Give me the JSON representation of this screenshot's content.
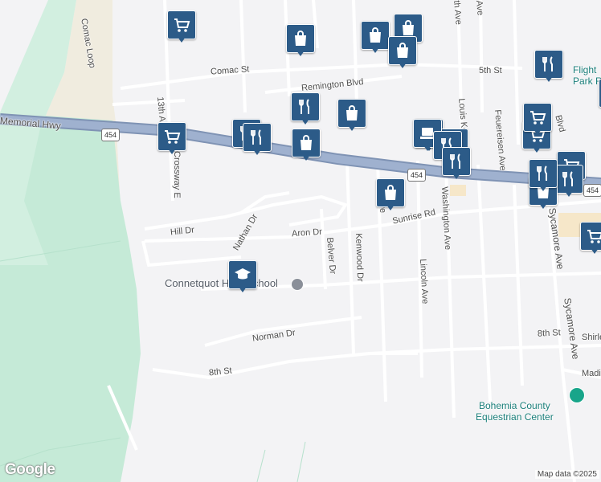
{
  "map": {
    "highway": {
      "name": "Memorial Hwy",
      "route_number": "454"
    },
    "streets": [
      {
        "id": "comac-loop",
        "name": "Comac Loop"
      },
      {
        "id": "comac-st",
        "name": "Comac St"
      },
      {
        "id": "remington-blvd",
        "name": "Remington Blvd"
      },
      {
        "id": "13th-ave",
        "name": "13th A"
      },
      {
        "id": "crossway-e",
        "name": "Crossway E"
      },
      {
        "id": "hill-dr",
        "name": "Hill Dr"
      },
      {
        "id": "nathan-dr",
        "name": "Nathan Dr"
      },
      {
        "id": "aron-dr",
        "name": "Aron Dr"
      },
      {
        "id": "belver-dr",
        "name": "Belver Dr"
      },
      {
        "id": "kenwood-dr",
        "name": "Kenwood Dr"
      },
      {
        "id": "sunrise-rd",
        "name": "Sunrise Rd"
      },
      {
        "id": "lincoln-ave",
        "name": "Lincoln Ave"
      },
      {
        "id": "washington-ave",
        "name": "Washington Ave"
      },
      {
        "id": "louis-kossuth",
        "name": "Louis Kossuth"
      },
      {
        "id": "feuereisen-ave",
        "name": "Feuereisen Ave"
      },
      {
        "id": "sycamore-ave",
        "name": "Sycamore Ave"
      },
      {
        "id": "5th-st",
        "name": "5th St"
      },
      {
        "id": "8th-st-east",
        "name": "8th St"
      },
      {
        "id": "8th-st-west",
        "name": "8th St"
      },
      {
        "id": "norman-dr",
        "name": "Norman Dr"
      },
      {
        "id": "shirley",
        "name": "Shirley"
      },
      {
        "id": "madi",
        "name": "Madi"
      },
      {
        "id": "lt-ave",
        "name": "lt Ave"
      },
      {
        "id": "th-ave",
        "name": "th Ave"
      },
      {
        "id": "blvd",
        "name": "Blvd"
      },
      {
        "id": "ave-top",
        "name": "Ave"
      }
    ],
    "places": {
      "school": "Connetquot High School",
      "equestrian_line1": "Bohemia County",
      "equestrian_line2": "Equestrian Center",
      "flight_line1": "Flight",
      "flight_line2": "Park Re"
    },
    "pins": [
      {
        "type": "cart-icon"
      },
      {
        "type": "bag-icon"
      },
      {
        "type": "bag-icon"
      },
      {
        "type": "bag-icon"
      },
      {
        "type": "bag-icon"
      },
      {
        "type": "fork-knife-icon"
      },
      {
        "type": "fork-knife-icon"
      },
      {
        "type": "bag-icon"
      },
      {
        "type": "fork-knife-icon"
      },
      {
        "type": "cart-icon"
      },
      {
        "type": "fork-knife-icon"
      },
      {
        "type": "fork-knife-icon"
      },
      {
        "type": "bag-icon"
      },
      {
        "type": "laptop-icon"
      },
      {
        "type": "cart-icon"
      },
      {
        "type": "fork-knife-icon"
      },
      {
        "type": "fork-knife-icon"
      },
      {
        "type": "cart-icon"
      },
      {
        "type": "fork-knife-icon"
      },
      {
        "type": "cart-icon"
      },
      {
        "type": "fork-knife-icon"
      },
      {
        "type": "bag-icon"
      },
      {
        "type": "bag-icon"
      },
      {
        "type": "cart-icon"
      },
      {
        "type": "graduation-cap-icon"
      },
      {
        "type": "fork-knife-icon"
      },
      {
        "type": "bag-icon"
      }
    ],
    "attribution": {
      "logo": "Google",
      "copyright": "Map data ©2025"
    },
    "colors": {
      "background": "#f3f3f5",
      "park": "#c5ead7",
      "highway": "#8fa3c4",
      "pin": "#2c5b88",
      "teal_label": "#1a7e7a"
    }
  }
}
